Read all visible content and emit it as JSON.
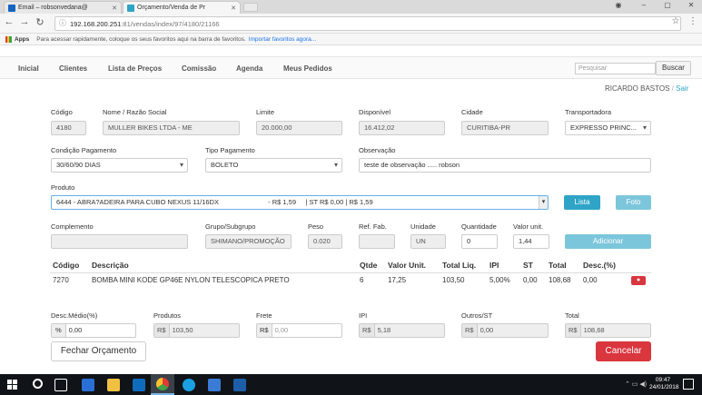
{
  "browser": {
    "tabs": [
      {
        "title": "Email – robsonvedana@"
      },
      {
        "title": "Orçamento/Venda de Pr"
      }
    ],
    "url_host": "192.168.200.251",
    "url_path": ":81/vendas/index/97/4180/21166",
    "bookmarks_label": "Apps",
    "bookmarks_hint": "Para acessar rapidamente, coloque os seus favoritos aqui na barra de favoritos.",
    "bookmarks_link": "Importar favoritos agora..."
  },
  "nav": {
    "items": [
      "Inicial",
      "Clientes",
      "Lista de Preços",
      "Comissão",
      "Agenda",
      "Meus Pedidos"
    ],
    "search_placeholder": "Pesquisar",
    "search_button": "Buscar"
  },
  "user": {
    "name": "RICARDO BASTOS",
    "separator": "/",
    "logout": "Sair"
  },
  "form": {
    "codigo_label": "Código",
    "codigo": "4180",
    "nome_label": "Nome / Razão Social",
    "nome": "MULLER BIKES LTDA - ME",
    "limite_label": "Limite",
    "limite": "20.000,00",
    "disponivel_label": "Disponível",
    "disponivel": "16.412,02",
    "cidade_label": "Cidade",
    "cidade": "CURITIBA-PR",
    "transportadora_label": "Transportadora",
    "transportadora": "EXPRESSO PRINC...",
    "condicao_label": "Condição Pagamento",
    "condicao": "30/60/90 DIAS",
    "tipo_label": "Tipo Pagamento",
    "tipo": "BOLETO",
    "observacao_label": "Observação",
    "observacao": "teste de observação ..... robson",
    "produto_label": "Produto",
    "produto": "6444 - ABRA?ADEIRA PARA CUBO NEXUS 11/16DX                          - R$ 1,59     | ST R$ 0,00 | R$ 1,59",
    "lista_button": "Lista",
    "foto_button": "Foto",
    "complemento_label": "Complemento",
    "complemento": "",
    "grupo_label": "Grupo/Subgrupo",
    "grupo": "SHIMANO/PROMOÇÃO",
    "peso_label": "Peso",
    "peso": "0.020",
    "ref_label": "Ref. Fab.",
    "ref": "",
    "unidade_label": "Unidade",
    "unidade": "UN",
    "quantidade_label": "Quantidade",
    "quantidade": "0",
    "valor_label": "Valor unit.",
    "valor": "1,44",
    "adicionar_button": "Adicionar"
  },
  "table": {
    "headers": [
      "Código",
      "Descrição",
      "Qtde",
      "Valor Unit.",
      "Total Liq.",
      "IPI",
      "ST",
      "Total",
      "Desc.(%)"
    ],
    "rows": [
      [
        "7270",
        "BOMBA MINI KODE GP46E NYLON TELESCOPICA PRETO",
        "6",
        "17,25",
        "103,50",
        "5,00%",
        "0,00",
        "108,68",
        "0,00"
      ]
    ]
  },
  "totals": {
    "desc_label": "Desc.Médio(%)",
    "desc_prefix": "%",
    "desc": "0,00",
    "produtos_label": "Produtos",
    "produtos_prefix": "R$",
    "produtos": "103,50",
    "frete_label": "Frete",
    "frete_prefix": "R$",
    "frete": "0,00",
    "ipi_label": "IPI",
    "ipi_prefix": "R$",
    "ipi": "5,18",
    "outros_label": "Outros/ST",
    "outros_prefix": "R$",
    "outros": "0,00",
    "total_label": "Total",
    "total_prefix": "R$",
    "total": "108,68"
  },
  "actions": {
    "fechar": "Fechar Orçamento",
    "cancelar": "Cancelar"
  },
  "taskbar": {
    "time": "09:47",
    "date": "24/01/2018"
  },
  "colors": {
    "primary": "#2fa4c7",
    "danger": "#d9363e",
    "taskbar": "#101418"
  }
}
